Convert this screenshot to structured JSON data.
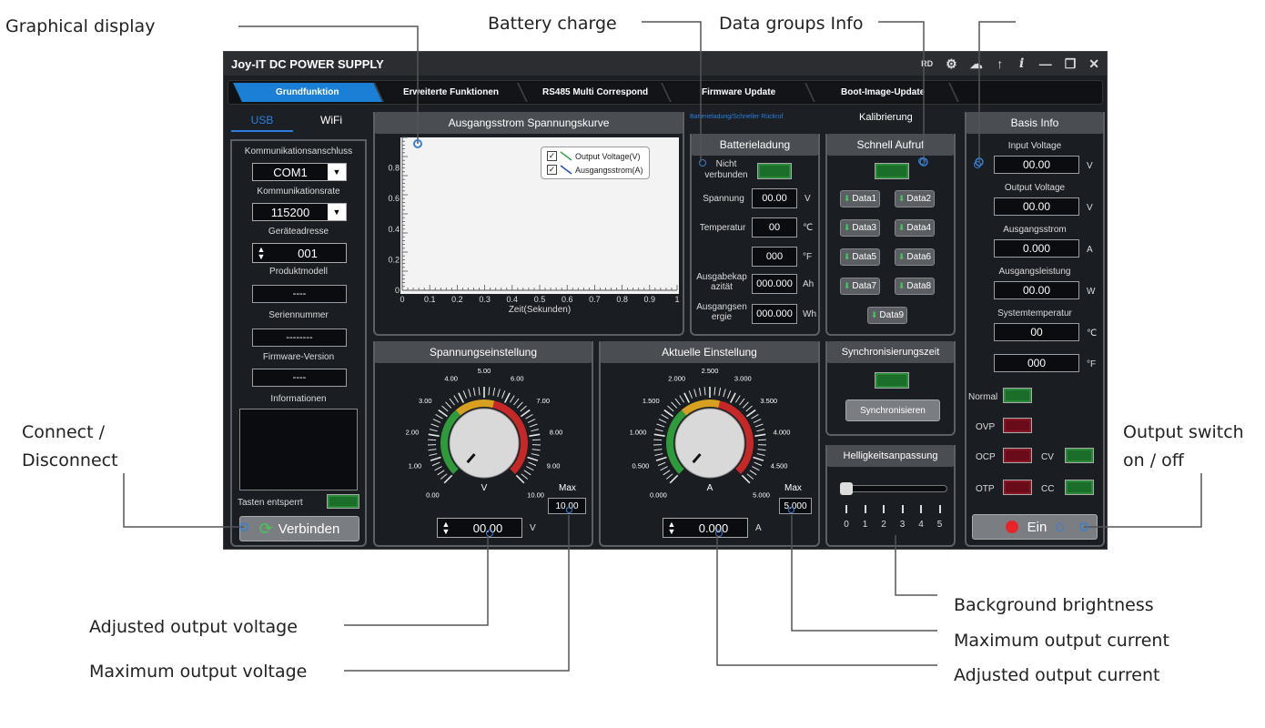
{
  "annotations": {
    "graphical_display": "Graphical display",
    "battery_charge": "Battery charge",
    "data_groups_info": "Data groups Info",
    "connect_disconnect_line1": "Connect /",
    "connect_disconnect_line2": "Disconnect",
    "output_switch_line1": "Output switch",
    "output_switch_line2": "on / off",
    "adjusted_output_voltage": "Adjusted output voltage",
    "maximum_output_voltage": "Maximum output voltage",
    "background_brightness": "Background brightness",
    "maximum_output_current": "Maximum output current",
    "adjusted_output_current": "Adjusted output current"
  },
  "window": {
    "title": "Joy-IT DC POWER SUPPLY",
    "rd_label": "RD",
    "icons": [
      "gear-icon",
      "cloud-icon",
      "upload-icon",
      "info-icon",
      "minimize-icon",
      "restore-icon",
      "close-icon"
    ]
  },
  "tabs": [
    "Grundfunktion",
    "Erweiterte Funktionen",
    "RS485 Multi Correspond",
    "Firmware Update",
    "Boot-Image-Update"
  ],
  "subtabs": {
    "battery_fast": "Batterieladung/Schneller Rückruf",
    "calibration": "Kalibrierung"
  },
  "connection": {
    "tab_usb": "USB",
    "tab_wifi": "WiFi",
    "port_label": "Kommunikationsanschluss",
    "port_value": "COM1",
    "rate_label": "Kommunikationsrate",
    "rate_value": "115200",
    "address_label": "Geräteadresse",
    "address_value": "001",
    "model_label": "Produktmodell",
    "model_value": "----",
    "serial_label": "Seriennummer",
    "serial_value": "--------",
    "firmware_label": "Firmware-Version",
    "firmware_value": "----",
    "info_label": "Informationen",
    "keys_label": "Tasten entsperrt",
    "connect_button": "Verbinden"
  },
  "chart": {
    "header": "Ausgangsstrom Spannungskurve",
    "xlabel": "Zeit(Sekunden)",
    "yticks": [
      "0",
      "0.2",
      "0.4",
      "0.6",
      "0.8"
    ],
    "xticks": [
      "0",
      "0.1",
      "0.2",
      "0.3",
      "0.4",
      "0.5",
      "0.6",
      "0.7",
      "0.8",
      "0.9",
      "1"
    ],
    "legend_voltage": "Output Voltage(V)",
    "legend_current": "Ausgangsstrom(A)"
  },
  "chart_data": {
    "type": "line",
    "title": "Ausgangsstrom Spannungskurve",
    "xlabel": "Zeit(Sekunden)",
    "ylabel": "",
    "xlim": [
      0,
      1
    ],
    "ylim": [
      0,
      1
    ],
    "series": [
      {
        "name": "Output Voltage(V)",
        "x": [],
        "y": []
      },
      {
        "name": "Ausgangsstrom(A)",
        "x": [],
        "y": []
      }
    ],
    "grid": true,
    "legend_position": "top-right"
  },
  "battery": {
    "header": "Batterieladung",
    "not_connected_line1": "Nicht",
    "not_connected_line2": "verbunden",
    "voltage_label": "Spannung",
    "voltage_value": "00.00",
    "voltage_unit": "V",
    "temp_label": "Temperatur",
    "temp_c_value": "00",
    "temp_c_unit": "℃",
    "temp_f_value": "000",
    "temp_f_unit": "°F",
    "capacity_label_1": "Ausgabekap",
    "capacity_label_2": "azität",
    "capacity_value": "000.000",
    "capacity_unit": "Ah",
    "energy_label_1": "Ausgangsen",
    "energy_label_2": "ergie",
    "energy_value": "000.000",
    "energy_unit": "Wh"
  },
  "quick_call": {
    "header": "Schnell Aufruf",
    "buttons": [
      "Data1",
      "Data2",
      "Data3",
      "Data4",
      "Data5",
      "Data6",
      "Data7",
      "Data8",
      "Data9"
    ]
  },
  "sync": {
    "header": "Synchronisierungszeit",
    "button": "Synchronisieren"
  },
  "brightness": {
    "header": "Helligkeitsanpassung",
    "ticks": [
      "0",
      "1",
      "2",
      "3",
      "4",
      "5"
    ],
    "level": 0
  },
  "voltage_setting": {
    "header": "Spannungseinstellung",
    "scale": [
      "0.00",
      "1.00",
      "2.00",
      "3.00",
      "4.00",
      "5.00",
      "6.00",
      "7.00",
      "8.00",
      "9.00",
      "10.00"
    ],
    "unit": "V",
    "max_label": "Max",
    "max_value": "10.00",
    "value": "00.00",
    "value_unit": "V"
  },
  "current_setting": {
    "header": "Aktuelle Einstellung",
    "scale": [
      "0.000",
      "0.500",
      "1.000",
      "1.500",
      "2.000",
      "2.500",
      "3.000",
      "3.500",
      "4.000",
      "4.500",
      "5.000"
    ],
    "unit": "A",
    "max_label": "Max",
    "max_value": "5.000",
    "value": "0.000",
    "value_unit": "A"
  },
  "basis": {
    "header": "Basis Info",
    "input_voltage_label": "Input Voltage",
    "input_voltage_value": "00.00",
    "input_voltage_unit": "V",
    "output_voltage_label": "Output Voltage",
    "output_voltage_value": "00.00",
    "output_voltage_unit": "V",
    "current_label": "Ausgangsstrom",
    "current_value": "0.000",
    "current_unit": "A",
    "power_label": "Ausgangsleistung",
    "power_value": "00.00",
    "power_unit": "W",
    "systemp_label": "Systemtemperatur",
    "systemp_c_value": "00",
    "systemp_c_unit": "℃",
    "systemp_f_value": "000",
    "systemp_f_unit": "°F",
    "normal_label": "Normal",
    "ovp_label": "OVP",
    "ocp_label": "OCP",
    "otp_label": "OTP",
    "cv_label": "CV",
    "cc_label": "CC",
    "output_button": "Ein"
  },
  "colors": {
    "accent_tab": "#1b7fd6",
    "led_green": "#1a6e2a",
    "led_red": "#6a0b1a",
    "power_red": "#e8242a",
    "refresh_green": "#47c94f"
  }
}
